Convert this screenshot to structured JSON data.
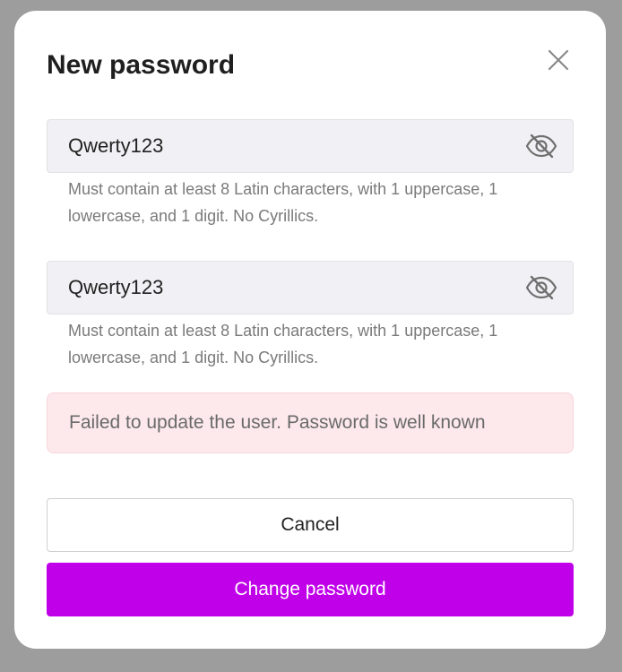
{
  "dialog": {
    "title": "New password",
    "close_icon": "close-icon"
  },
  "fields": [
    {
      "value": "Qwerty123",
      "toggle_icon": "eye-off-icon",
      "hint": "Must contain at least 8 Latin characters, with 1 uppercase, 1 lowercase, and 1 digit. No Cyrillics."
    },
    {
      "value": "Qwerty123",
      "toggle_icon": "eye-off-icon",
      "hint": "Must contain at least 8 Latin characters, with 1 uppercase, 1 lowercase, and 1 digit. No Cyrillics."
    }
  ],
  "error": {
    "message": "Failed to update the user. Password is well known"
  },
  "buttons": {
    "cancel_label": "Cancel",
    "submit_label": "Change password"
  },
  "colors": {
    "primary": "#bf00e8",
    "error_bg": "#fde9ec",
    "overlay": "#9d9d9d",
    "input_bg": "#f1f0f4"
  }
}
